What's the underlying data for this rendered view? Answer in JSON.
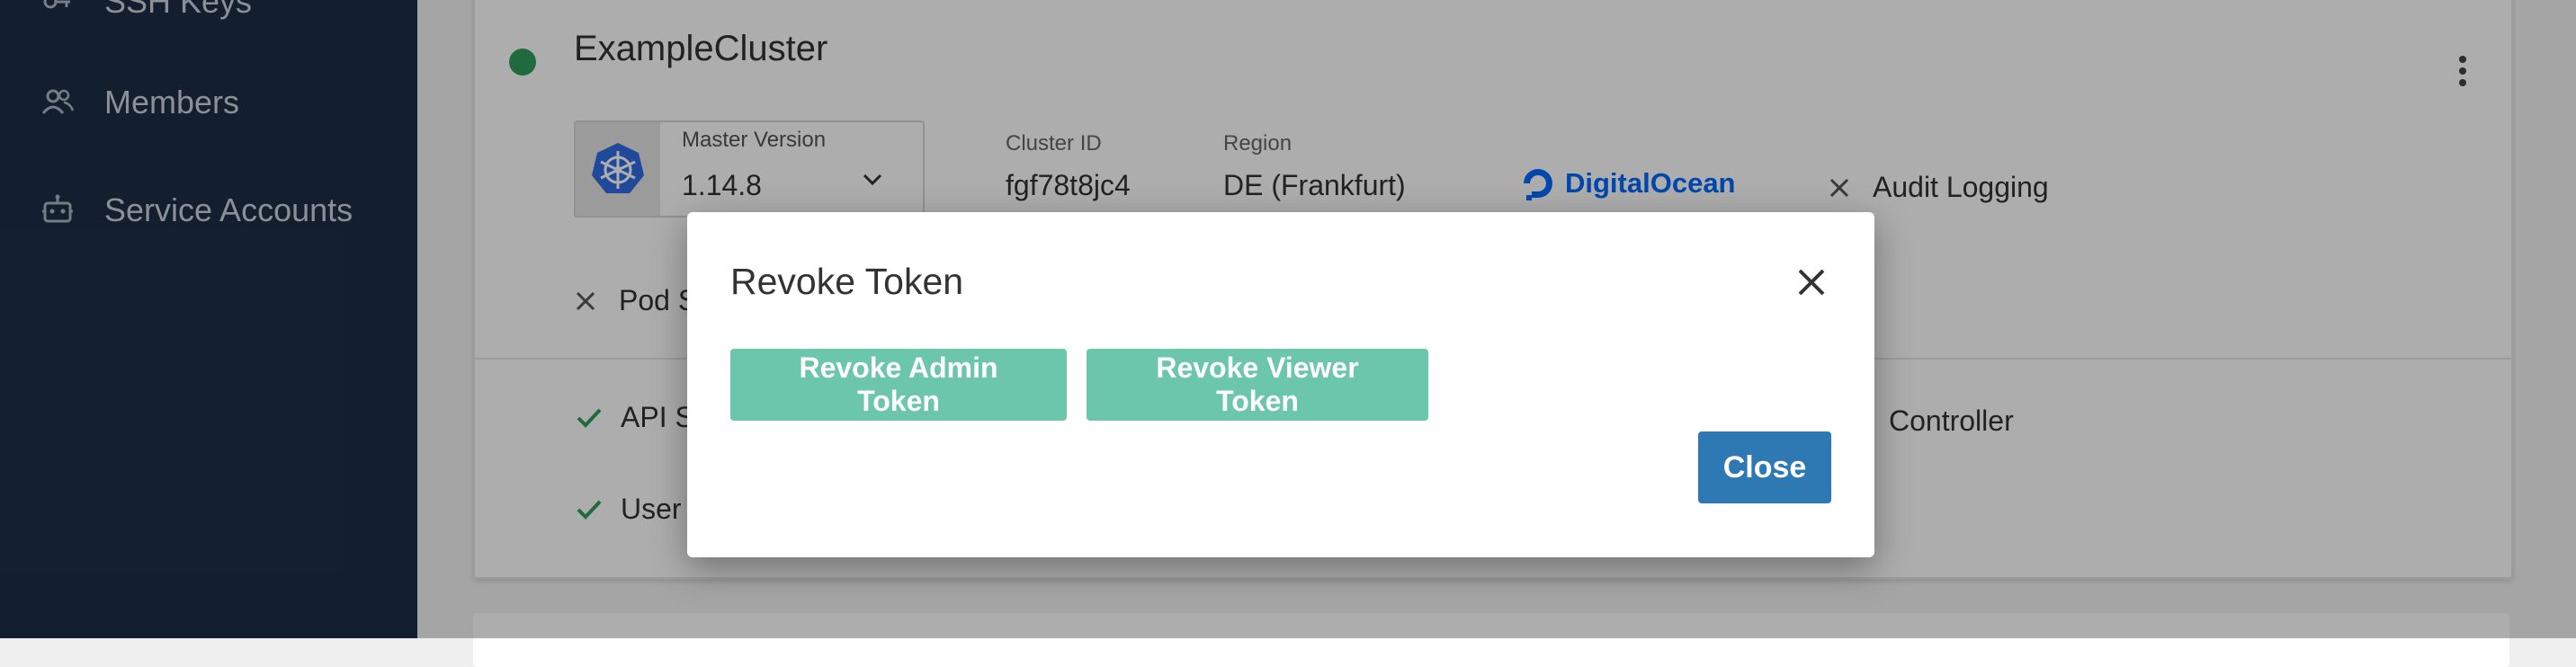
{
  "sidebar": {
    "items": [
      {
        "label": "SSH Keys",
        "icon": "key-icon"
      },
      {
        "label": "Members",
        "icon": "members-icon"
      },
      {
        "label": "Service Accounts",
        "icon": "robot-icon"
      }
    ]
  },
  "cluster": {
    "name": "ExampleCluster",
    "status_color": "#2e9e5b",
    "master_version_label": "Master Version",
    "master_version": "1.14.8",
    "cluster_id_label": "Cluster ID",
    "cluster_id": "fgf78t8jc4",
    "region_label": "Region",
    "region": "DE (Frankfurt)",
    "provider": "DigitalOcean",
    "audit_logging": "Audit Logging",
    "pod_security_partial": "Pod S",
    "api_partial": "API S",
    "controller_partial": "Controller",
    "user_partial": "User"
  },
  "dialog": {
    "title": "Revoke Token",
    "revoke_admin_label": "Revoke Admin Token",
    "revoke_viewer_label": "Revoke Viewer Token",
    "close_label": "Close"
  },
  "colors": {
    "sidebar_bg": "#1d2f46",
    "teal": "#6cc6ab",
    "primary": "#2e78b4",
    "success": "#2e9e5b",
    "digitalocean": "#0069ff"
  }
}
